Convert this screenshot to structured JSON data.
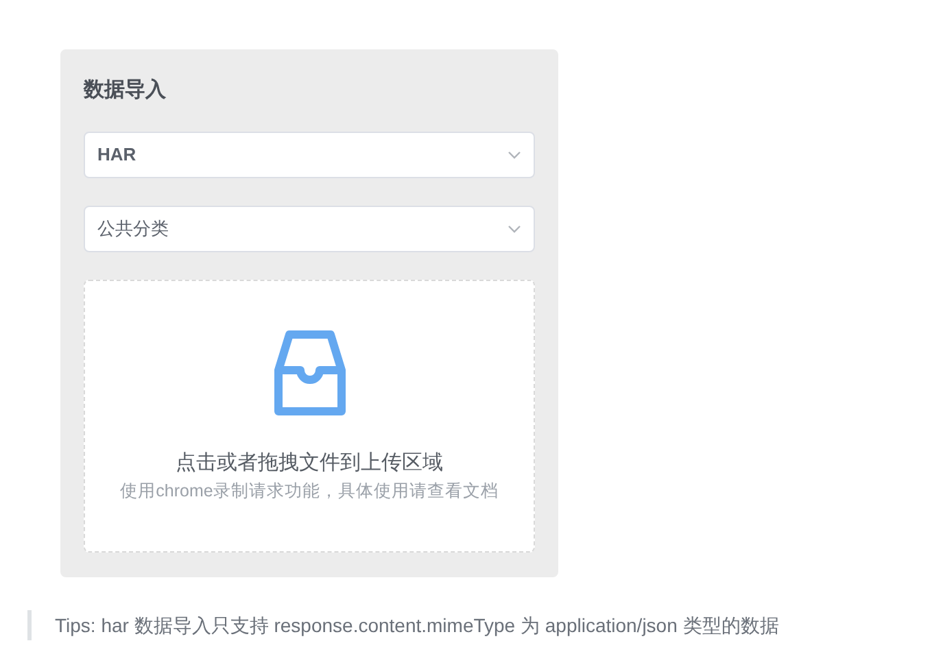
{
  "panel": {
    "title": "数据导入",
    "selects": [
      {
        "value": "HAR",
        "bold": true
      },
      {
        "value": "公共分类",
        "bold": false
      }
    ],
    "upload": {
      "title": "点击或者拖拽文件到上传区域",
      "hint": "使用chrome录制请求功能，具体使用请查看文档"
    }
  },
  "tip": "Tips: har 数据导入只支持 response.content.mimeType 为 application/json 类型的数据"
}
